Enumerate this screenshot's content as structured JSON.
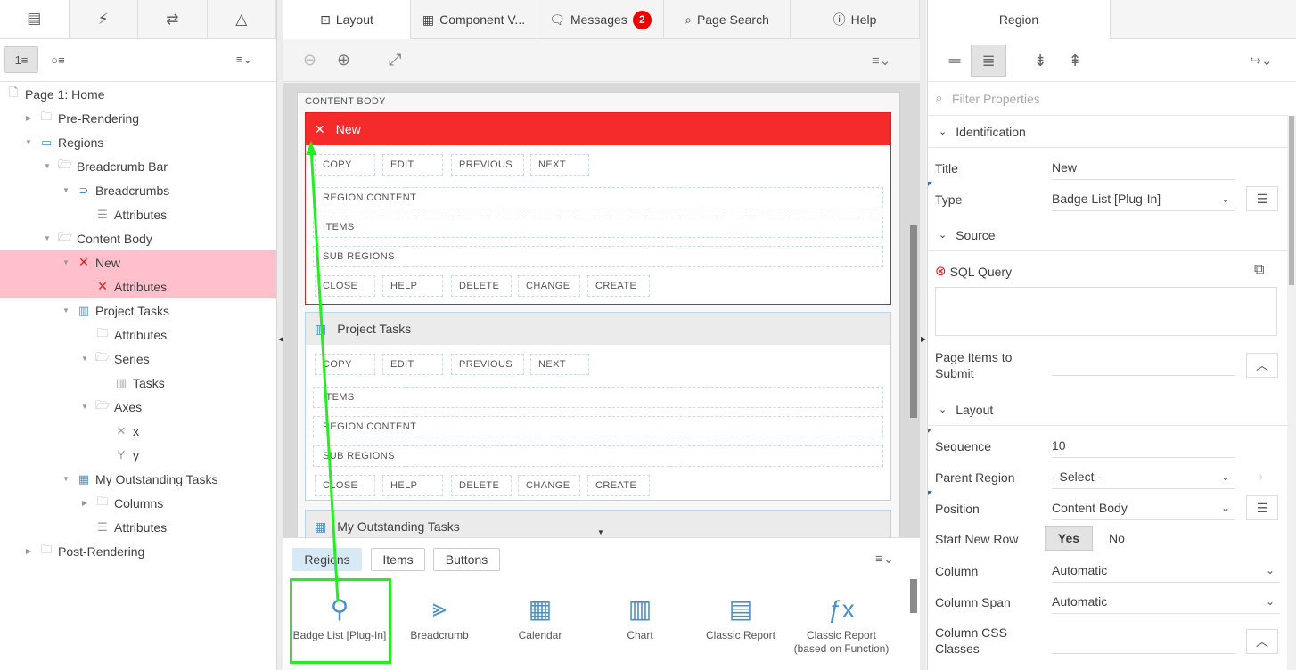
{
  "left": {
    "tabs": [
      "rendering-tab",
      "dynamic-actions-tab",
      "processing-tab",
      "shared-components-tab"
    ],
    "tree": [
      {
        "label": "Page 1: Home",
        "level": 0,
        "icon": "page"
      },
      {
        "label": "Pre-Rendering",
        "level": 1,
        "icon": "folder"
      },
      {
        "label": "Regions",
        "level": 1,
        "icon": "region"
      },
      {
        "label": "Breadcrumb Bar",
        "level": 2,
        "icon": "folder-open"
      },
      {
        "label": "Breadcrumbs",
        "level": 3,
        "icon": "breadcrumb"
      },
      {
        "label": "Attributes",
        "level": 4,
        "icon": "list"
      },
      {
        "label": "Content Body",
        "level": 2,
        "icon": "folder-open"
      },
      {
        "label": "New",
        "level": 3,
        "icon": "error",
        "selected": true
      },
      {
        "label": "Attributes",
        "level": 4,
        "icon": "error",
        "selected": true
      },
      {
        "label": "Project Tasks",
        "level": 3,
        "icon": "chart"
      },
      {
        "label": "Attributes",
        "level": 4,
        "icon": "folder"
      },
      {
        "label": "Series",
        "level": 4,
        "icon": "folder-open"
      },
      {
        "label": "Tasks",
        "level": 5,
        "icon": "chart-small"
      },
      {
        "label": "Axes",
        "level": 4,
        "icon": "folder-open"
      },
      {
        "label": "x",
        "level": 5,
        "icon": "x-axis"
      },
      {
        "label": "y",
        "level": 5,
        "icon": "y-axis"
      },
      {
        "label": "My Outstanding Tasks",
        "level": 3,
        "icon": "grid"
      },
      {
        "label": "Columns",
        "level": 4,
        "icon": "folder"
      },
      {
        "label": "Attributes",
        "level": 4,
        "icon": "list"
      },
      {
        "label": "Post-Rendering",
        "level": 1,
        "icon": "folder"
      }
    ]
  },
  "center": {
    "tabs": {
      "layout": "Layout",
      "component_view": "Component V...",
      "messages": "Messages",
      "messages_count": "2",
      "page_search": "Page Search",
      "help": "Help"
    },
    "content_body_label": "CONTENT BODY",
    "region_new": {
      "title": "New",
      "top_buttons": [
        "COPY",
        "EDIT",
        "PREVIOUS",
        "NEXT"
      ],
      "slots": [
        "REGION CONTENT",
        "ITEMS",
        "SUB REGIONS"
      ],
      "bottom_buttons": [
        "CLOSE",
        "HELP",
        "DELETE",
        "CHANGE",
        "CREATE"
      ]
    },
    "region_tasks": {
      "title": "Project Tasks",
      "top_buttons": [
        "COPY",
        "EDIT",
        "PREVIOUS",
        "NEXT"
      ],
      "slots": [
        "ITEMS",
        "REGION CONTENT",
        "SUB REGIONS"
      ],
      "bottom_buttons": [
        "CLOSE",
        "HELP",
        "DELETE",
        "CHANGE",
        "CREATE"
      ]
    },
    "region_outstanding": {
      "title": "My Outstanding Tasks"
    },
    "gallery": {
      "tabs": {
        "regions": "Regions",
        "items": "Items",
        "buttons": "Buttons"
      },
      "items": [
        {
          "label": "Badge List [Plug-In]",
          "icon": "plug-icon"
        },
        {
          "label": "Breadcrumb",
          "icon": "breadcrumb-icon"
        },
        {
          "label": "Calendar",
          "icon": "calendar-icon"
        },
        {
          "label": "Chart",
          "icon": "chart-icon"
        },
        {
          "label": "Classic Report",
          "icon": "table-icon"
        },
        {
          "label": "Classic Report (based on Function)",
          "icon": "function-icon"
        }
      ]
    }
  },
  "right": {
    "tab": "Region",
    "filter_placeholder": "Filter Properties",
    "sections": {
      "identification": "Identification",
      "source": "Source",
      "layout": "Layout"
    },
    "props": {
      "title_label": "Title",
      "title_value": "New",
      "type_label": "Type",
      "type_value": "Badge List [Plug-In]",
      "sql_label": "SQL Query",
      "items_submit_label": "Page Items to Submit",
      "sequence_label": "Sequence",
      "sequence_value": "10",
      "parent_label": "Parent Region",
      "parent_value": "- Select -",
      "position_label": "Position",
      "position_value": "Content Body",
      "newrow_label": "Start New Row",
      "yes": "Yes",
      "no": "No",
      "column_label": "Column",
      "column_value": "Automatic",
      "span_label": "Column Span",
      "span_value": "Automatic",
      "css_label": "Column CSS Classes"
    }
  },
  "colors": {
    "error_red": "#f52a2a",
    "selected_pink": "#ffc0cb",
    "drag_green": "#22ee22",
    "accent_blue": "#4a90c8"
  }
}
